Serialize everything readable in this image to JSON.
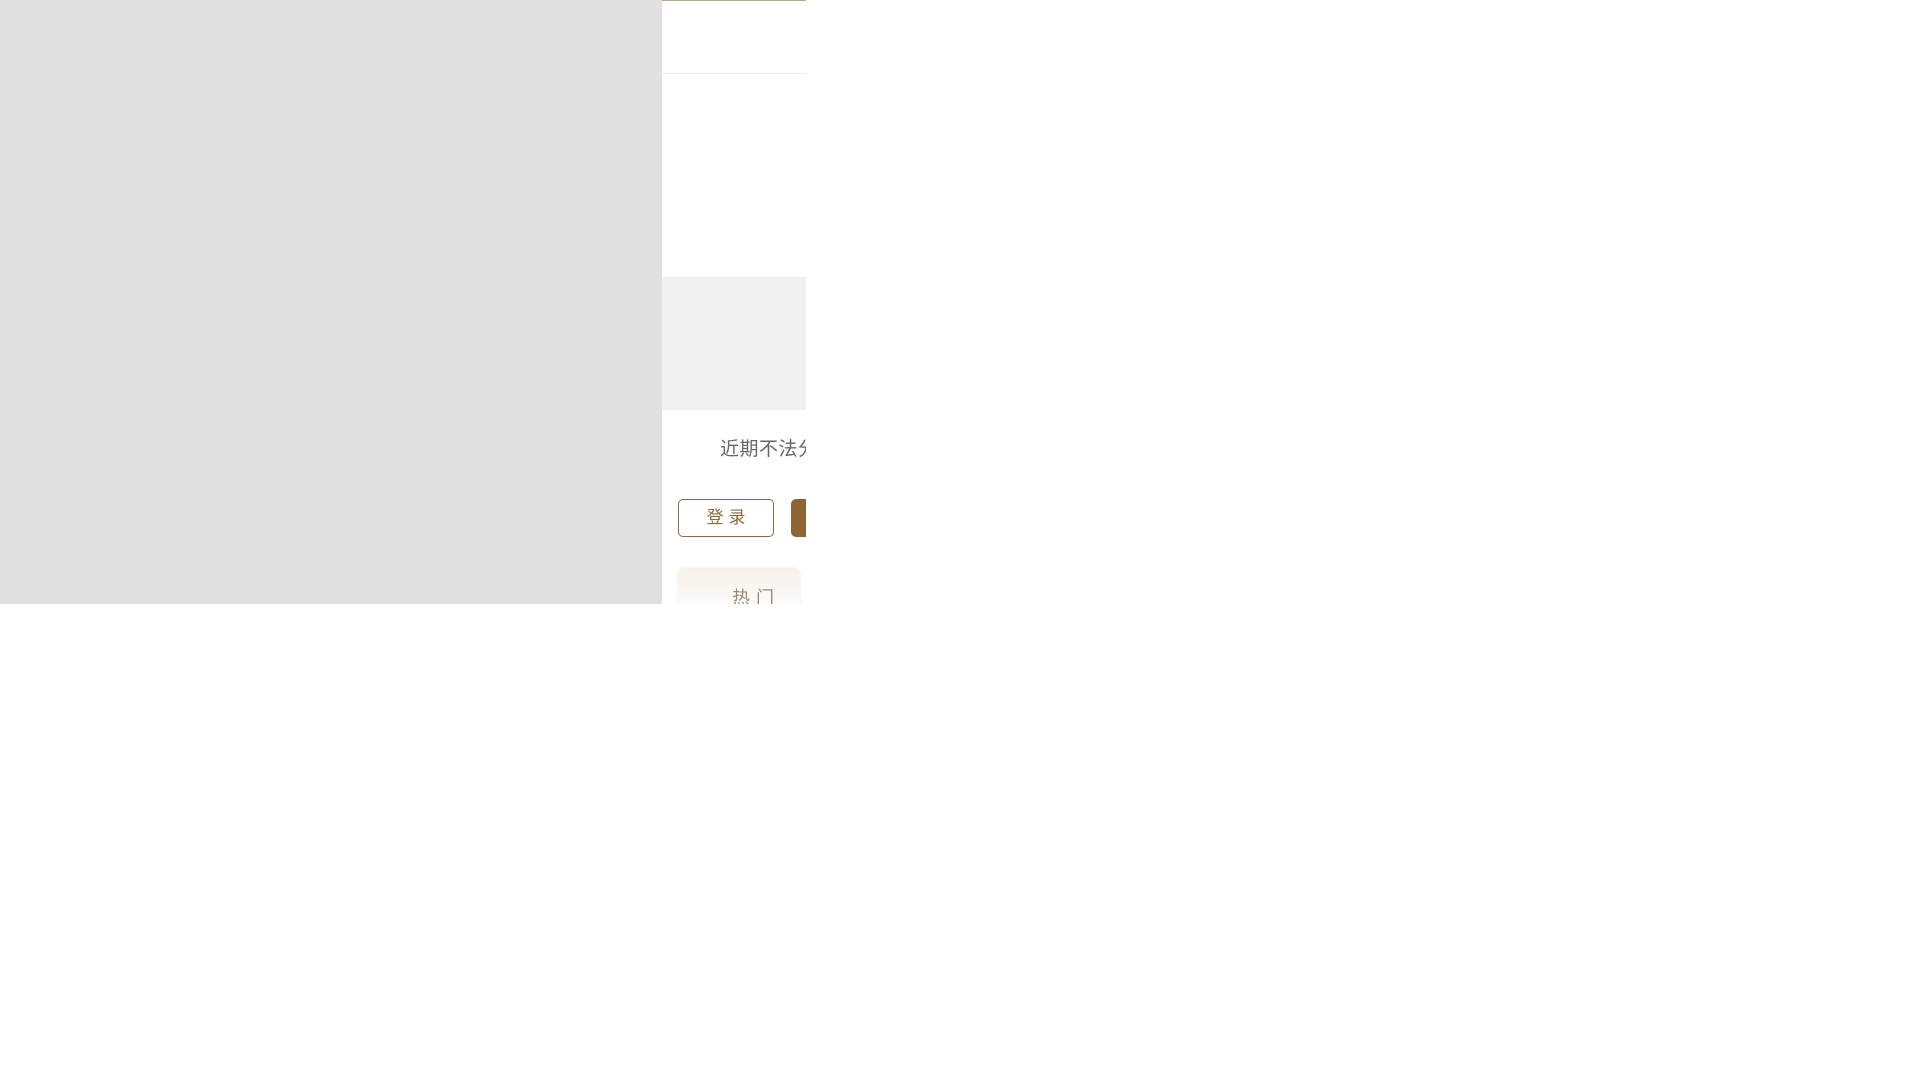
{
  "notice": {
    "text": "近期不法分"
  },
  "auth": {
    "login_label": "登录",
    "register_label": ""
  },
  "tabs": {
    "hot_label": "热门"
  },
  "colors": {
    "accent": "#8c6534",
    "placeholder_grey": "#e1e1e1",
    "banner_grey": "#f1f1f1"
  }
}
